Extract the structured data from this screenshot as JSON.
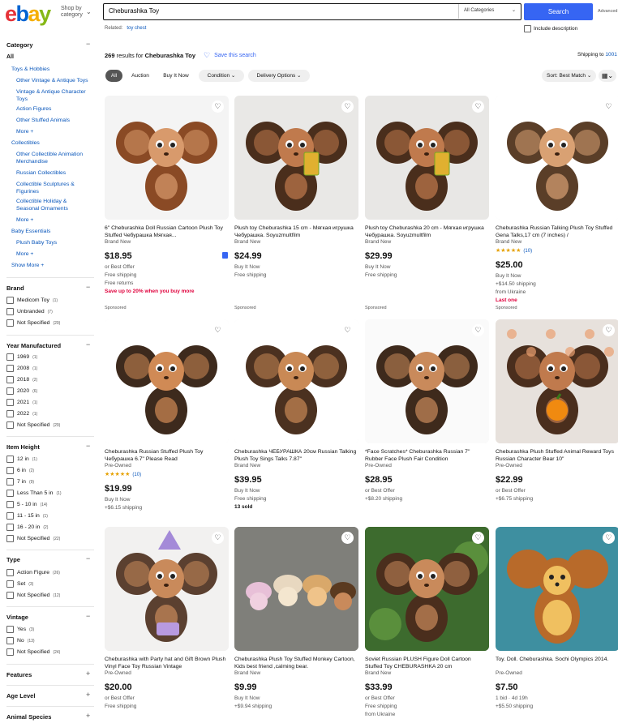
{
  "header": {
    "logo": [
      "e",
      "b",
      "a",
      "y"
    ],
    "shop_by": "Shop by category",
    "search_value": "Cheburashka Toy",
    "category": "All Categories",
    "search_btn": "Search",
    "advanced": "Advanced",
    "related_label": "Related:",
    "related_link": "toy chest",
    "include_desc": "Include description"
  },
  "results": {
    "count": "269",
    "count_suffix": "results for",
    "query": "Cheburashka Toy",
    "save": "Save this search",
    "ship_label": "Shipping to",
    "ship_zip": "1001"
  },
  "filters": {
    "pills": [
      "All",
      "Auction",
      "Buy It Now"
    ],
    "dropdowns": [
      "Condition",
      "Delivery Options"
    ],
    "sort": "Sort: Best Match"
  },
  "sidebar": {
    "category_title": "Category",
    "all": "All",
    "links": [
      {
        "t": "Toys & Hobbies",
        "indent": 0
      },
      {
        "t": "Other Vintage & Antique Toys",
        "indent": 1
      },
      {
        "t": "Vintage & Antique Character Toys",
        "indent": 1
      },
      {
        "t": "Action Figures",
        "indent": 1
      },
      {
        "t": "Other Stuffed Animals",
        "indent": 1
      },
      {
        "t": "More +",
        "indent": 1
      },
      {
        "t": "Collectibles",
        "indent": 0
      },
      {
        "t": "Other Collectible Animation Merchandise",
        "indent": 1
      },
      {
        "t": "Russian Collectibles",
        "indent": 1
      },
      {
        "t": "Collectible Sculptures & Figurines",
        "indent": 1
      },
      {
        "t": "Collectible Holiday & Seasonal Ornaments",
        "indent": 1
      },
      {
        "t": "More +",
        "indent": 1
      },
      {
        "t": "Baby Essentials",
        "indent": 0
      },
      {
        "t": "Plush Baby Toys",
        "indent": 1
      },
      {
        "t": "More +",
        "indent": 1
      },
      {
        "t": "Show More +",
        "indent": 0
      }
    ],
    "brand": {
      "title": "Brand",
      "opts": [
        [
          "Medicom Toy",
          "(1)"
        ],
        [
          "Unbranded",
          "(7)"
        ],
        [
          "Not Specified",
          "(29)"
        ]
      ]
    },
    "year": {
      "title": "Year Manufactured",
      "opts": [
        [
          "1969",
          "(1)"
        ],
        [
          "2008",
          "(1)"
        ],
        [
          "2018",
          "(2)"
        ],
        [
          "2020",
          "(6)"
        ],
        [
          "2021",
          "(1)"
        ],
        [
          "2022",
          "(1)"
        ],
        [
          "Not Specified",
          "(29)"
        ]
      ]
    },
    "height": {
      "title": "Item Height",
      "opts": [
        [
          "12 in",
          "(1)"
        ],
        [
          "6 in",
          "(2)"
        ],
        [
          "7 in",
          "(9)"
        ],
        [
          "Less Than 5 in",
          "(1)"
        ],
        [
          "5 - 10 in",
          "(14)"
        ],
        [
          "11 - 15 in",
          "(1)"
        ],
        [
          "16 - 20 in",
          "(2)"
        ],
        [
          "Not Specified",
          "(22)"
        ]
      ]
    },
    "type": {
      "title": "Type",
      "opts": [
        [
          "Action Figure",
          "(26)"
        ],
        [
          "Set",
          "(3)"
        ],
        [
          "Not Specified",
          "(12)"
        ]
      ]
    },
    "vintage": {
      "title": "Vintage",
      "opts": [
        [
          "Yes",
          "(3)"
        ],
        [
          "No",
          "(13)"
        ],
        [
          "Not Specified",
          "(24)"
        ]
      ]
    },
    "collapsed": [
      "Features",
      "Age Level",
      "Animal Species"
    ]
  },
  "items": [
    {
      "title": "6\" Cheburashka Doll Russian Cartoon Plush Toy Stuffed Чебурашка Мягкая...",
      "cond": "Brand New",
      "price": "$18.95",
      "lines": [
        "or Best Offer",
        "Free shipping",
        "Free returns"
      ],
      "promo": "Save up to 20% when you buy more",
      "spons": "Sponsored",
      "bg": "#f4f4f4",
      "body": "#8a4a25",
      "face": "#d89a6c",
      "variant": "a"
    },
    {
      "title": "Plush toy Cheburashka 15 cm - Мягкая игрушка Чебурашка. Soyuzmultfilm",
      "cond": "Brand New",
      "price": "$24.99",
      "lines": [
        "Buy It Now",
        "Free shipping"
      ],
      "spons": "Sponsored",
      "bg": "#e9e8e6",
      "body": "#4a2e1c",
      "face": "#c07a4d",
      "variant": "b"
    },
    {
      "title": "Plush toy Cheburashka 20 cm - Мягкая игрушка Чебурашка. Soyuzmultfilm",
      "cond": "Brand New",
      "price": "$29.99",
      "lines": [
        "Buy It Now",
        "Free shipping"
      ],
      "spons": "Sponsored",
      "bg": "#e8e7e5",
      "body": "#4a2e1c",
      "face": "#c07a4d",
      "variant": "b"
    },
    {
      "title": "Cheburashka Russian Talking Plush Toy Stuffed Gena Talks,17 cm (7 inches) /",
      "cond": "Brand New",
      "rating": "★★★★★",
      "reviews": "(10)",
      "price": "$25.00",
      "lines": [
        "Buy It Now",
        "+$14.50 shipping",
        "from Ukraine"
      ],
      "alert": "Last one",
      "spons": "Sponsored",
      "bg": "#ffffff",
      "body": "#5a3e28",
      "face": "#d9a173",
      "variant": "c"
    },
    {
      "title": "Cheburashka Russian Stuffed Plush Toy Чебурашка 6.7\" Please Read",
      "cond": "Pre-Owned",
      "rating": "★★★★★",
      "reviews": "(10)",
      "price": "$19.99",
      "lines": [
        "Buy It Now",
        "+$6.15 shipping"
      ],
      "bg": "#ffffff",
      "body": "#3d2a1d",
      "face": "#d08a55",
      "variant": "c"
    },
    {
      "title": "Cheburashka ЧЕБУРАШКА 20см Russian Talking Plush Toy Sings Talks 7.87\"",
      "cond": "Brand New",
      "price": "$39.95",
      "lines": [
        "Buy It Now",
        "Free shipping"
      ],
      "sold": "13 sold",
      "bg": "#ffffff",
      "body": "#4b3120",
      "face": "#c98955",
      "variant": "c"
    },
    {
      "title": "*Face Scratches* Cheburashka Russian 7\" Rubber Face Plush Fair Condition",
      "cond": "Pre-Owned",
      "price": "$28.95",
      "lines": [
        "or Best Offer",
        "+$8.20 shipping"
      ],
      "bg": "#fafafa",
      "body": "#3e2a1c",
      "face": "#c98a5b",
      "variant": "c"
    },
    {
      "title": "Cheburashka Plush Stuffed Animal Reward Toys Russian Character Bear 10\"",
      "cond": "Pre-Owned",
      "price": "$22.99",
      "lines": [
        "or Best Offer",
        "+$6.75 shipping"
      ],
      "bg": "#e7e1dc",
      "body": "#4a2e1d",
      "face": "#c07a4d",
      "variant": "d"
    },
    {
      "title": "Cheburashka with Party hat and Gift Brown Plush Vinyl Face Toy Russian Vintage",
      "cond": "Pre-Owned",
      "price": "$20.00",
      "lines": [
        "or Best Offer",
        "Free shipping"
      ],
      "bg": "#f2f1f0",
      "body": "#5b4030",
      "face": "#c98a5b",
      "variant": "e"
    },
    {
      "title": "Cheburashka Plush Toy Stuffed Monkey Cartoon, Kids best friend ,calming bear.",
      "cond": "Brand New",
      "price": "$9.99",
      "lines": [
        "Buy It Now",
        "+$9.94 shipping"
      ],
      "bg": "#8a8a86",
      "body": "#c9a67a",
      "face": "#e8c9a1",
      "variant": "f"
    },
    {
      "title": "Soviet Russian PLUSH Figure Doll Cartoon Stuffed Toy CHEBURASHKA 20 cm",
      "cond": "Brand New",
      "price": "$33.99",
      "lines": [
        "or Best Offer",
        "Free shipping",
        "from Ukraine"
      ],
      "bg": "#3d6b2e",
      "body": "#4a2e1d",
      "face": "#c98a5b",
      "variant": "g"
    },
    {
      "title": "Toy. Doll. Cheburashka. Sochi Olympics 2014.",
      "cond": "Pre-Owned",
      "price": "$7.50",
      "lines": [
        "1 bid · 4d 19h",
        "+$5.50 shipping"
      ],
      "bg": "#3e8fa0",
      "body": "#b86a2a",
      "face": "#f0c060",
      "variant": "h"
    }
  ]
}
